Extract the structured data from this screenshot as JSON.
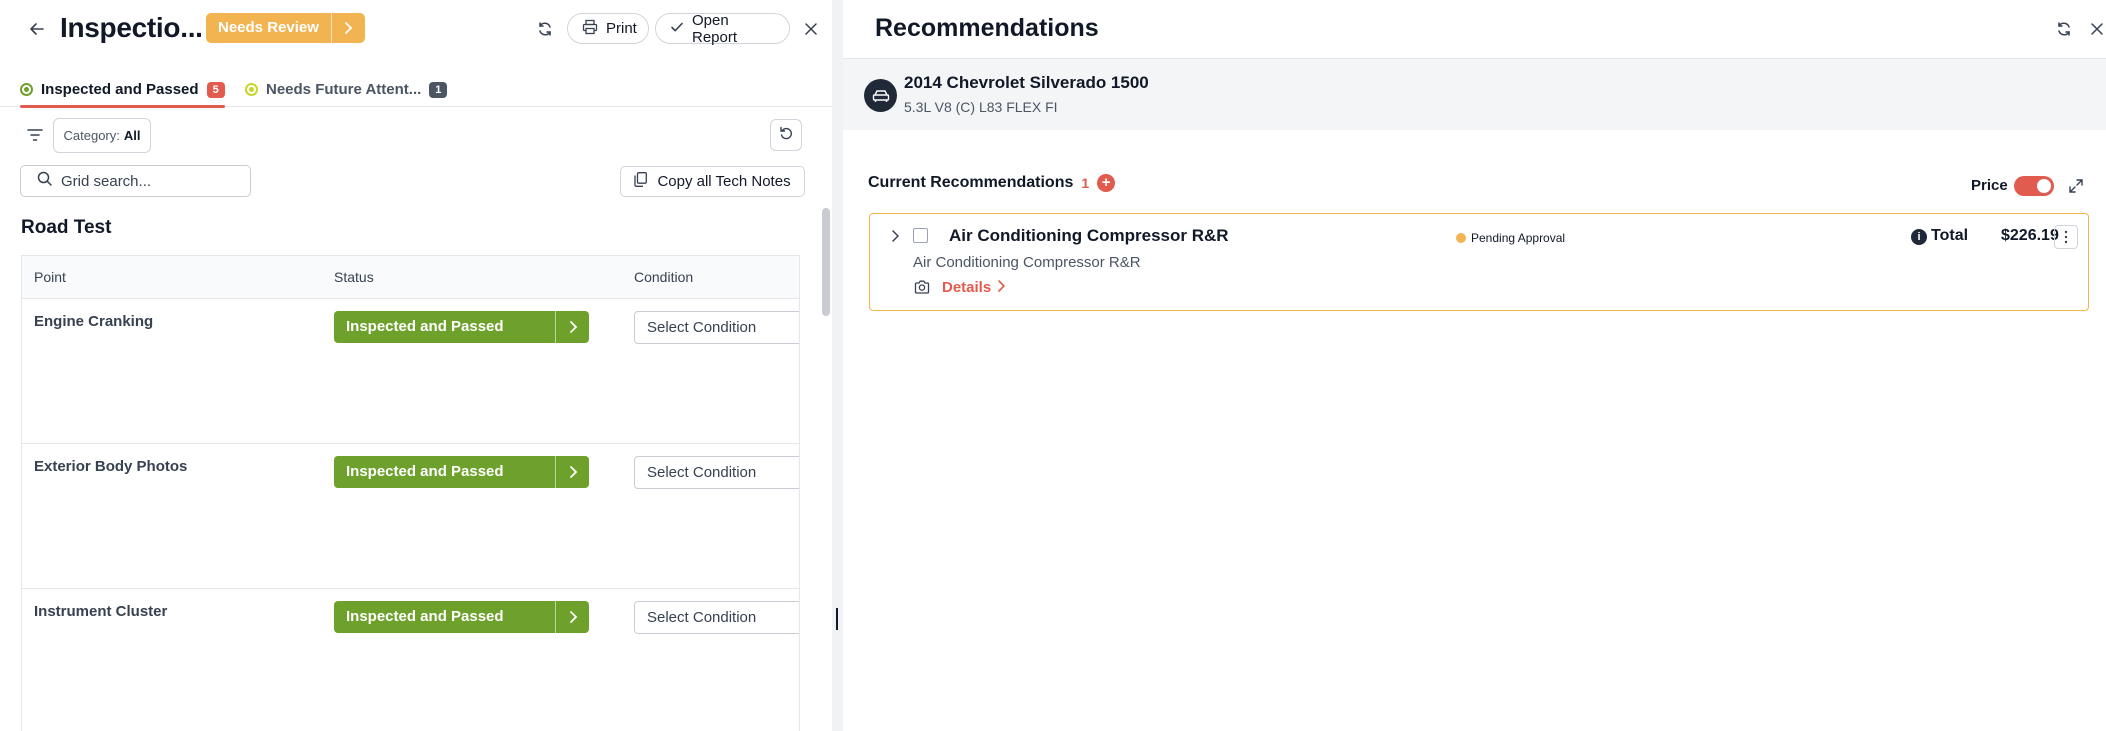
{
  "inspection": {
    "title": "Inspectio...",
    "status_label": "Needs Review",
    "print_label": "Print",
    "open_report_label": "Open Report",
    "tabs": [
      {
        "label": "Inspected and Passed",
        "count": "5",
        "color": "#6ea12b"
      },
      {
        "label": "Needs Future Attent...",
        "count": "1",
        "color": "#c8d62a"
      }
    ],
    "filter": {
      "category_prefix": "Category:",
      "category_value": "All"
    },
    "search": {
      "placeholder": "Grid search..."
    },
    "copy_notes_label": "Copy all Tech Notes",
    "section_title": "Road Test",
    "grid": {
      "columns": [
        "Point",
        "Status",
        "Condition"
      ],
      "rows": [
        {
          "point": "Engine Cranking",
          "status": "Inspected and Passed",
          "condition": "Select Condition"
        },
        {
          "point": "Exterior Body Photos",
          "status": "Inspected and Passed",
          "condition": "Select Condition"
        },
        {
          "point": "Instrument Cluster",
          "status": "Inspected and Passed",
          "condition": "Select Condition"
        }
      ]
    }
  },
  "recommendations": {
    "title": "Recommendations",
    "vehicle": {
      "name": "2014 Chevrolet Silverado 1500",
      "engine": "5.3L V8 (C) L83 FLEX FI"
    },
    "current_label": "Current Recommendations",
    "current_count": "1",
    "price_label": "Price",
    "price_toggle_on": true,
    "items": [
      {
        "title": "Air Conditioning Compressor R&R",
        "subtitle": "Air Conditioning Compressor R&R",
        "details_label": "Details",
        "status": "Pending Approval",
        "total_label": "Total",
        "total_amount": "$226.19"
      }
    ]
  },
  "colors": {
    "accent": "#e15c4e",
    "review": "#f2b451",
    "passed": "#6ea12b"
  }
}
